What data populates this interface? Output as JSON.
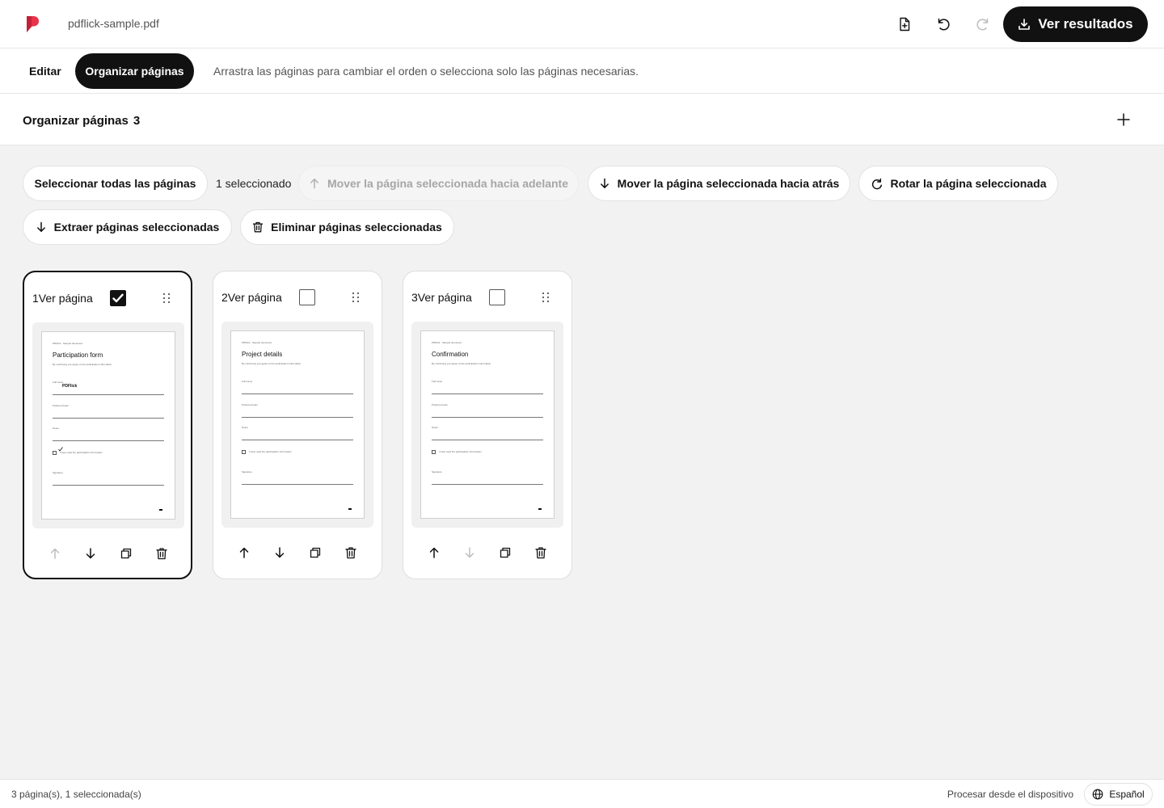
{
  "app": {
    "logo_icon": "pdflick-logo",
    "brand_color": "#e8334a",
    "filename": "pdflick-sample.pdf"
  },
  "toolbar": {
    "add_file_icon": "file-plus-icon",
    "undo_icon": "undo-icon",
    "redo_icon": "redo-icon",
    "redo_enabled": false,
    "results_label": "Ver resultados",
    "results_icon": "download-icon"
  },
  "tabs": {
    "edit_label": "Editar",
    "organize_label": "Organizar páginas",
    "active": "organize",
    "hint": "Arrastra las páginas para cambiar el orden o selecciona solo las páginas necesarias."
  },
  "section": {
    "title": "Organizar páginas",
    "count": "3",
    "add_icon": "plus-icon"
  },
  "actions": {
    "select_all": "Seleccionar todas las páginas",
    "selected_count": "1 seleccionado",
    "move_forward": "Mover la página seleccionada hacia adelante",
    "move_forward_enabled": false,
    "move_back": "Mover la página seleccionada hacia atrás",
    "rotate": "Rotar la página seleccionada",
    "extract": "Extraer páginas seleccionadas",
    "delete": "Eliminar páginas seleccionadas"
  },
  "pages": [
    {
      "label": "1Ver página",
      "checked": true,
      "title": "Participation form",
      "filled_value": "PDFlick",
      "header_text": "PDFlick · Sample document",
      "subtitle": "By continuing you agree to the participation information",
      "fields": [
        "Full name",
        "Preferred team",
        "Notes"
      ],
      "checkbox_text": "I have read the participation information",
      "checkbox_ticked": true,
      "signature_label": "Signature",
      "move_up_enabled": false,
      "move_down_enabled": true
    },
    {
      "label": "2Ver página",
      "checked": false,
      "title": "Project details",
      "filled_value": "",
      "header_text": "PDFlick · Sample document",
      "subtitle": "By continuing you agree to the participation information",
      "fields": [
        "Full name",
        "Preferred team",
        "Notes"
      ],
      "checkbox_text": "I have read the participation information",
      "checkbox_ticked": false,
      "signature_label": "Signature",
      "move_up_enabled": true,
      "move_down_enabled": true
    },
    {
      "label": "3Ver página",
      "checked": false,
      "title": "Confirmation",
      "filled_value": "",
      "header_text": "PDFlick · Sample document",
      "subtitle": "By continuing you agree to the participation information",
      "fields": [
        "Full name",
        "Preferred team",
        "Notes"
      ],
      "checkbox_text": "I have read the participation information",
      "checkbox_ticked": false,
      "signature_label": "Signature",
      "move_up_enabled": true,
      "move_down_enabled": false
    }
  ],
  "footer": {
    "status": "3 página(s), 1 seleccionada(s)",
    "process": "Procesar desde el dispositivo",
    "language": "Español",
    "language_icon": "globe-icon"
  }
}
